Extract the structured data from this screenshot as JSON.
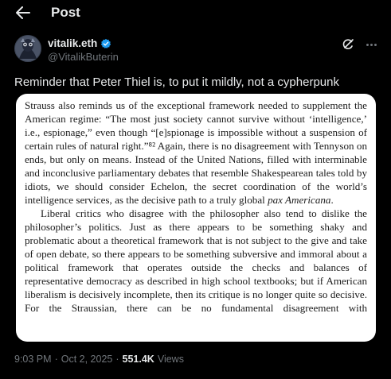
{
  "header": {
    "title": "Post"
  },
  "tweet": {
    "display_name": "vitalik.eth",
    "handle": "@VitalikButerin",
    "text": "Reminder that Peter Thiel is, to put it mildly, not a cypherpunk",
    "time": "9:03 PM",
    "dot": "·",
    "date": "Oct 2, 2025",
    "views_count": "551.4K",
    "views_label": "Views"
  },
  "image_text": {
    "p1": "Strauss also reminds us of the exceptional framework needed to supplement the American regime: “The most just society cannot survive without ‘intelligence,’ i.e., espionage,” even though “[e]spionage is impossible without a suspension of certain rules of natural right.”⁸² Again, there is no disagreement with Tennyson on ends, but only on means. Instead of the United Nations, filled with interminable and inconclusive parliamentary debates that resemble Shakespearean tales told by idiots, we should consider Echelon, the secret coordination of the world’s intelligence services, as the decisive path to a truly global",
    "p1_italic": "pax Americana",
    "p1_end": ".",
    "p2": "Liberal critics who disagree with the philosopher also tend to dislike the philosopher’s politics. Just as there appears to be something shaky and problematic about a theoretical framework that is not subject to the give and take of open debate, so there appears to be something subversive and immoral about a political framework that operates outside the checks and balances of representative democracy as described in high school textbooks; but if American liberalism is decisively incomplete, then its critique is no longer quite so decisive. For the Straussian, there can be no fundamental disagreement with"
  },
  "colors": {
    "background": "#000000",
    "text_primary": "#e7e9ea",
    "text_secondary": "#71767b",
    "verified": "#1d9bf0"
  },
  "icons": {
    "back": "arrow-left-icon",
    "verified": "verified-badge-icon",
    "grok": "grok-icon",
    "more": "more-dots-icon"
  }
}
